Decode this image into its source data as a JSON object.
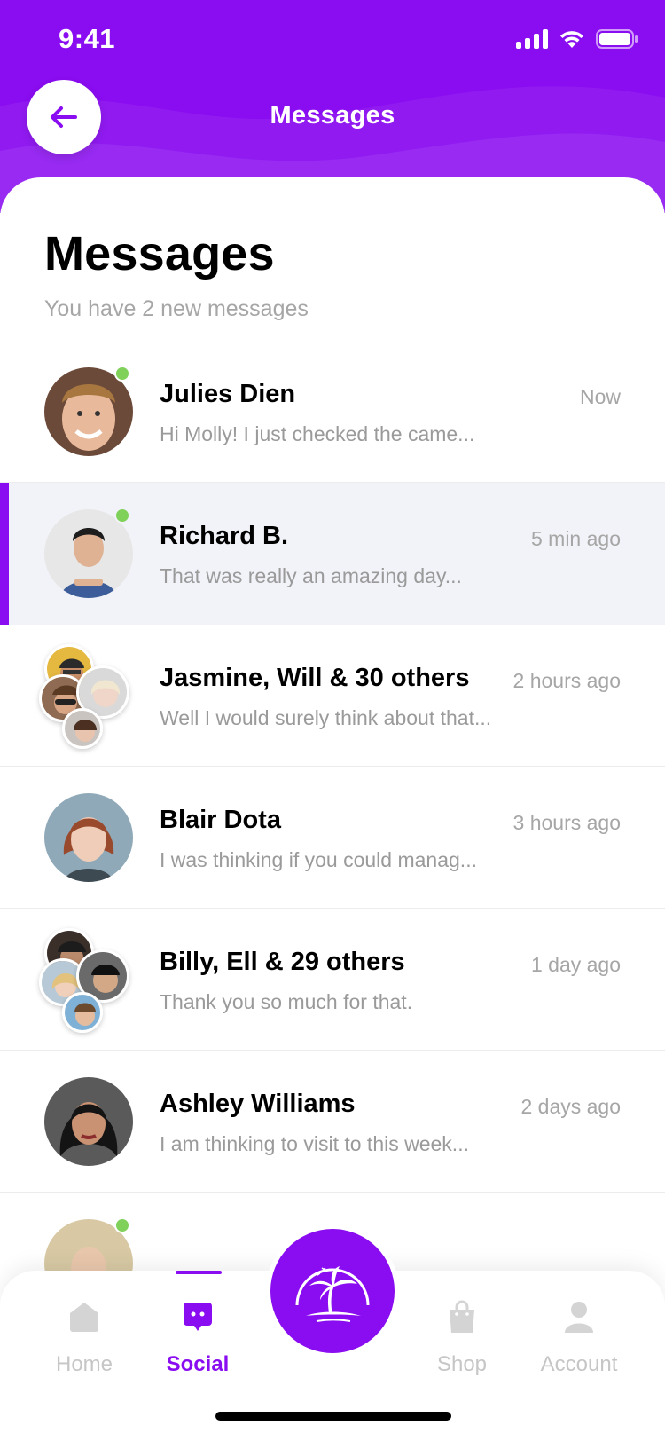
{
  "status_bar": {
    "time": "9:41"
  },
  "header": {
    "title": "Messages"
  },
  "page": {
    "title": "Messages",
    "subtitle": "You have 2 new messages"
  },
  "conversations": [
    {
      "name": "Julies Dien",
      "preview": "Hi Molly! I just checked the came...",
      "time": "Now",
      "online": true,
      "active": false
    },
    {
      "name": "Richard B.",
      "preview": "That was really an amazing day...",
      "time": "5 min ago",
      "online": true,
      "active": true
    },
    {
      "name": "Jasmine, Will & 30 others",
      "preview": "Well I would surely think about that...",
      "time": "2 hours ago",
      "online": false,
      "active": false,
      "group": true
    },
    {
      "name": "Blair Dota",
      "preview": "I was thinking if you could manag...",
      "time": "3 hours ago",
      "online": false,
      "active": false
    },
    {
      "name": "Billy, Ell & 29 others",
      "preview": "Thank you so much for that.",
      "time": "1 day ago",
      "online": false,
      "active": false,
      "group": true
    },
    {
      "name": "Ashley Williams",
      "preview": "I am thinking to visit to this week...",
      "time": "2 days ago",
      "online": false,
      "active": false
    }
  ],
  "nav": {
    "home": "Home",
    "social": "Social",
    "shop": "Shop",
    "account": "Account",
    "active": "social"
  },
  "colors": {
    "accent": "#8a0cf0",
    "online": "#7fd15a",
    "inactive": "#c6c6c6"
  },
  "icons": {
    "back": "arrow-left-icon",
    "fab": "palm-tree-island-icon"
  }
}
